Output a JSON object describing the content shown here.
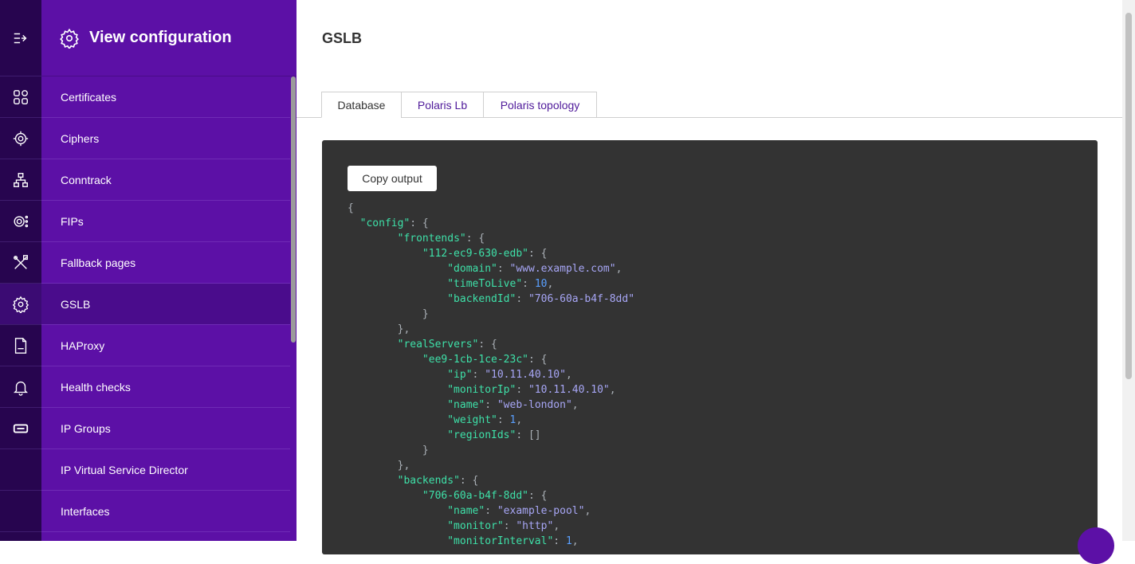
{
  "sidebar": {
    "title": "View configuration",
    "items": [
      {
        "label": "Certificates",
        "icon": "grid-icon"
      },
      {
        "label": "Ciphers",
        "icon": "gear-network-icon"
      },
      {
        "label": "Conntrack",
        "icon": "network-icon"
      },
      {
        "label": "FIPs",
        "icon": "gear-dots-icon"
      },
      {
        "label": "Fallback pages",
        "icon": "tools-icon"
      },
      {
        "label": "GSLB",
        "icon": "gear-icon"
      },
      {
        "label": "HAProxy",
        "icon": "log-file-icon"
      },
      {
        "label": "Health checks",
        "icon": "bell-icon"
      },
      {
        "label": "IP Groups",
        "icon": "ticket-icon"
      },
      {
        "label": "IP Virtual Service Director",
        "icon": ""
      },
      {
        "label": "Interfaces",
        "icon": ""
      }
    ],
    "active": "GSLB"
  },
  "main": {
    "title": "GSLB",
    "tabs": [
      {
        "label": "Database",
        "active": true
      },
      {
        "label": "Polaris Lb",
        "active": false
      },
      {
        "label": "Polaris topology",
        "active": false
      }
    ],
    "copy_label": "Copy output"
  },
  "colors": {
    "rail": "#27054f",
    "panel": "#5c10a6",
    "active_item": "#4a0c8c",
    "code_bg": "#333333",
    "key": "#3ee0a8",
    "string": "#a7a6f5",
    "number": "#5aa0ff"
  }
}
